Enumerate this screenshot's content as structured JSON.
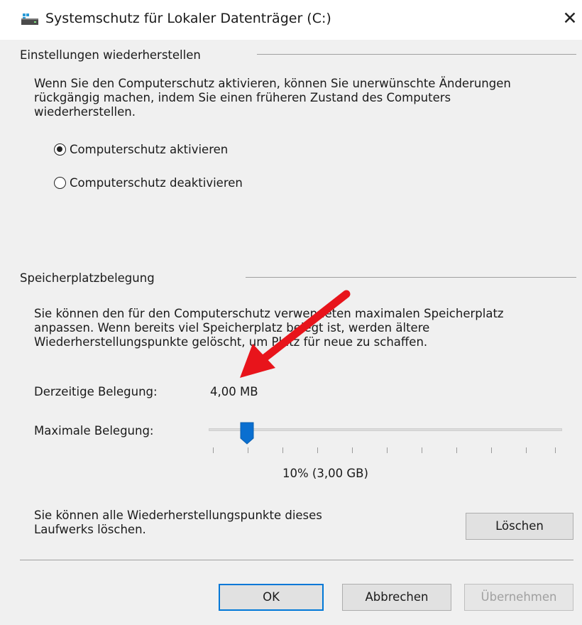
{
  "window": {
    "title": "Systemschutz für Lokaler Datenträger (C:)",
    "close_symbol": "✕",
    "icon": "drive-icon"
  },
  "restore_settings": {
    "heading": "Einstellungen wiederherstellen",
    "description_lines": [
      "Wenn Sie den Computerschutz aktivieren, können Sie unerwünschte Änderungen",
      "rückgängig machen, indem Sie einen früheren Zustand des Computers",
      "wiederherstellen."
    ],
    "options": [
      {
        "label": "Computerschutz aktivieren",
        "checked": true
      },
      {
        "label": "Computerschutz deaktivieren",
        "checked": false
      }
    ]
  },
  "disk_usage": {
    "heading": "Speicherplatzbelegung",
    "description_lines": [
      "Sie können den für den Computerschutz verwendeten maximalen Speicherplatz",
      "anpassen. Wenn bereits viel Speicherplatz belegt ist, werden ältere",
      "Wiederherstellungspunkte gelöscht, um Platz für neue zu schaffen."
    ],
    "current_label": "Derzeitige Belegung:",
    "current_value": "4,00 MB",
    "max_label": "Maximale Belegung:",
    "slider_percent": 10,
    "slider_value_text": "10% (3,00 GB)",
    "delete_text_lines": [
      "Sie können alle Wiederherstellungspunkte dieses",
      "Laufwerks löschen."
    ],
    "delete_button": "Löschen"
  },
  "footer": {
    "ok_button": "OK",
    "cancel_button": "Abbrechen",
    "apply_button": "Übernehmen"
  },
  "colors": {
    "accent": "#0078d7",
    "annotation_arrow": "#e8141b"
  }
}
